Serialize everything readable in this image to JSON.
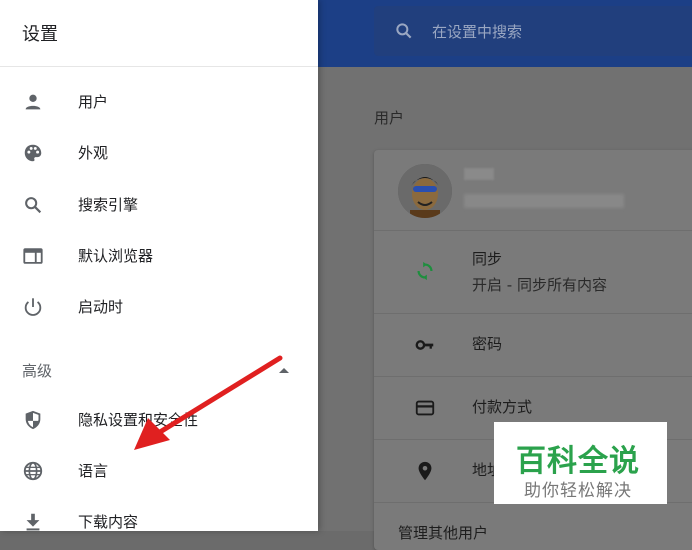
{
  "drawer": {
    "title": "设置",
    "items": [
      {
        "label": "用户",
        "icon": "person-icon"
      },
      {
        "label": "外观",
        "icon": "palette-icon"
      },
      {
        "label": "搜索引擎",
        "icon": "search-icon"
      },
      {
        "label": "默认浏览器",
        "icon": "browser-icon"
      },
      {
        "label": "启动时",
        "icon": "power-icon"
      }
    ],
    "advanced_label": "高级",
    "advanced_items": [
      {
        "label": "隐私设置和安全性",
        "icon": "shield-icon"
      },
      {
        "label": "语言",
        "icon": "globe-icon"
      },
      {
        "label": "下载内容",
        "icon": "download-icon"
      }
    ]
  },
  "search": {
    "placeholder": "在设置中搜索"
  },
  "main": {
    "section_title": "用户",
    "rows": [
      {
        "label": "同步",
        "sublabel": "开启 - 同步所有内容",
        "icon": "sync-icon"
      },
      {
        "label": "密码",
        "icon": "key-icon"
      },
      {
        "label": "付款方式",
        "icon": "credit-card-icon"
      },
      {
        "label": "地址",
        "icon": "location-pin-icon"
      },
      {
        "label": "管理其他用户"
      }
    ]
  },
  "watermark": {
    "line1": "百科全说",
    "line2": "助你轻松解决"
  },
  "colors": {
    "header_blue": "#1c3f86",
    "sync_green": "#1e8e3e",
    "arrow_red": "#e02020",
    "watermark_green": "#2ba24c"
  }
}
